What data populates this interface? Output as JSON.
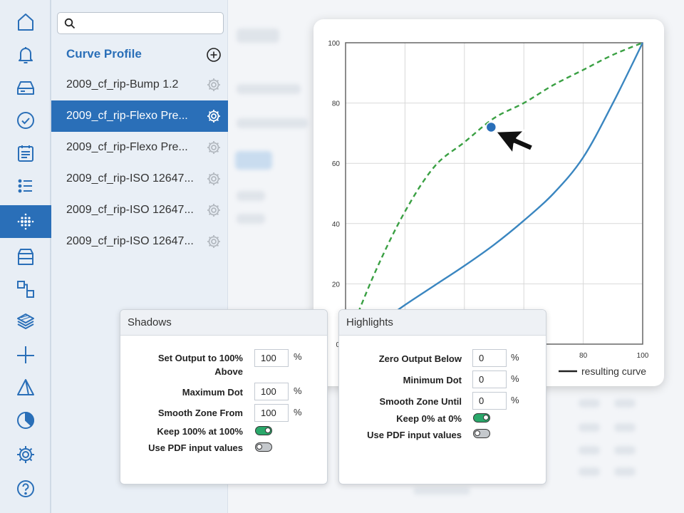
{
  "sidebar": {
    "items": [
      {
        "icon": "home-icon"
      },
      {
        "icon": "bell-icon"
      },
      {
        "icon": "drive-icon"
      },
      {
        "icon": "check-circle-icon"
      },
      {
        "icon": "calendar-icon"
      },
      {
        "icon": "list-icon"
      },
      {
        "icon": "dot-grid-icon",
        "active": true
      },
      {
        "icon": "box-icon"
      },
      {
        "icon": "workflow-icon"
      },
      {
        "icon": "layers-icon"
      },
      {
        "icon": "cut-line-icon"
      },
      {
        "icon": "triangle-icon"
      },
      {
        "icon": "pie-icon"
      },
      {
        "icon": "gear-icon"
      },
      {
        "icon": "help-icon"
      }
    ]
  },
  "profile_panel": {
    "search": {
      "placeholder": ""
    },
    "heading": "Curve Profile",
    "items": [
      {
        "label": "2009_cf_rip-Bump 1.2",
        "selected": false
      },
      {
        "label": "2009_cf_rip-Flexo Pre...",
        "selected": true
      },
      {
        "label": "2009_cf_rip-Flexo Pre...",
        "selected": false
      },
      {
        "label": "2009_cf_rip-ISO 12647...",
        "selected": false
      },
      {
        "label": "2009_cf_rip-ISO 12647...",
        "selected": false
      },
      {
        "label": "2009_cf_rip-ISO 12647...",
        "selected": false
      }
    ]
  },
  "chart_data": {
    "type": "line",
    "xlim": [
      0,
      100
    ],
    "ylim": [
      0,
      100
    ],
    "x_ticks": [
      "0",
      "20",
      "40",
      "60",
      "80",
      "100"
    ],
    "y_ticks": [
      "0",
      "20",
      "40",
      "60",
      "80",
      "100"
    ],
    "visible_x_tick_labels": [
      "80",
      "100"
    ],
    "grid": true,
    "legend": "bottom-right",
    "legend_label": "resulting curve",
    "series": [
      {
        "style": "solid",
        "color": "#3a86c0",
        "x": [
          0,
          10,
          20,
          30,
          40,
          50,
          60,
          70,
          80,
          90,
          100
        ],
        "y": [
          0,
          6,
          13,
          19.5,
          26,
          33,
          41,
          50,
          62,
          80,
          100
        ]
      },
      {
        "style": "dashed",
        "color": "#3aa043",
        "x": [
          0,
          10,
          20,
          30,
          40,
          50,
          60,
          70,
          80,
          90,
          100
        ],
        "y": [
          0,
          24,
          44,
          59,
          67,
          75,
          80,
          86,
          91,
          96,
          100
        ]
      }
    ],
    "control_point": {
      "x": 49,
      "y": 72
    }
  },
  "shadows": {
    "title": "Shadows",
    "set_output_label_1": "Set Output to 100%",
    "set_output_label_2": "Above",
    "set_output_value": "100",
    "max_dot_label": "Maximum Dot",
    "max_dot_value": "100",
    "smooth_from_label": "Smooth Zone From",
    "smooth_from_value": "100",
    "pct": "%",
    "keep_label": "Keep 100% at 100%",
    "keep_on": true,
    "pdf_label": "Use PDF input values",
    "pdf_on": false
  },
  "highlights": {
    "title": "Highlights",
    "zero_below_label": "Zero Output Below",
    "zero_below_value": "0",
    "min_dot_label": "Minimum Dot",
    "min_dot_value": "0",
    "smooth_until_label": "Smooth Zone Until",
    "smooth_until_value": "0",
    "pct": "%",
    "keep_label": "Keep 0% at 0%",
    "keep_on": true,
    "pdf_label": "Use PDF input values",
    "pdf_on": false
  },
  "colors": {
    "accent": "#2a6fb8",
    "toggle_on": "#2aa86a",
    "curve_solid": "#3a86c0",
    "curve_dashed": "#3aa043"
  }
}
